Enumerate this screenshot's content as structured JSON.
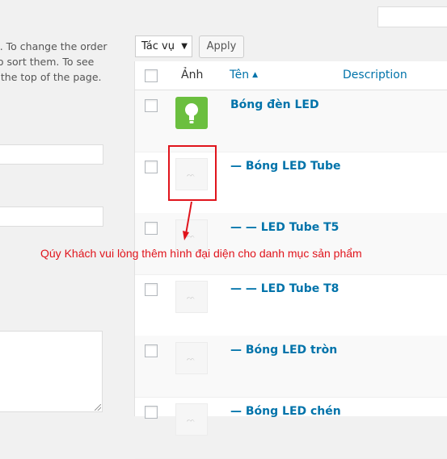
{
  "help_text": [
    "e. To change the order",
    " to sort them. To see",
    "t the top of the page."
  ],
  "bulk": {
    "select_value": "Tác vụ",
    "apply_label": "Apply"
  },
  "table": {
    "columns": {
      "image": "Ảnh",
      "name": "Tên",
      "sort_indicator": "▲",
      "description": "Description"
    },
    "rows": [
      {
        "name": "Bóng đèn LED",
        "thumb": "green-bulb"
      },
      {
        "name": "— Bóng LED Tube",
        "thumb": "placeholder"
      },
      {
        "name": "— — LED Tube T5",
        "thumb": "placeholder"
      },
      {
        "name": "— — LED Tube T8",
        "thumb": "placeholder"
      },
      {
        "name": "— Bóng LED tròn",
        "thumb": "placeholder"
      },
      {
        "name": "— Bóng LED chén",
        "thumb": "placeholder"
      }
    ]
  },
  "annotation": {
    "text": "Qúy Khách vui lòng thêm hình đại diện cho danh mục sản phẩm",
    "color": "#e0141c"
  },
  "colors": {
    "link": "#0073aa",
    "bulb_tile": "#6bbf3f"
  }
}
